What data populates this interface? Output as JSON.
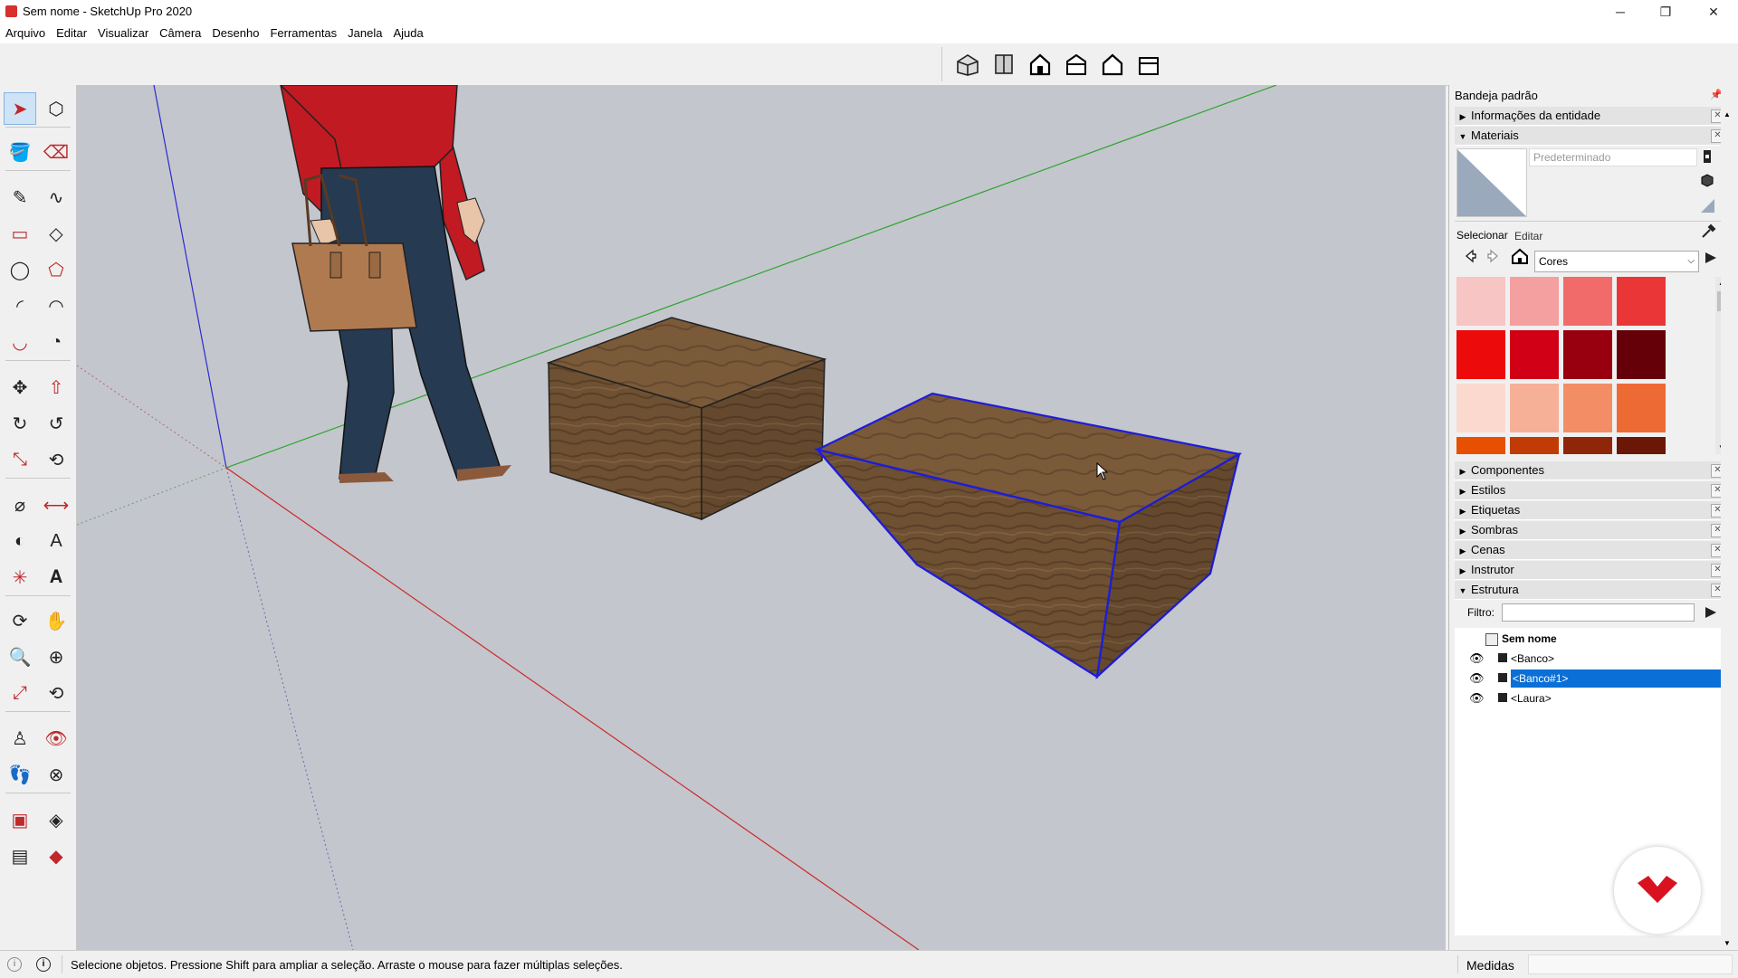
{
  "window": {
    "title": "Sem nome - SketchUp Pro 2020",
    "minimize": "─",
    "restore": "❐",
    "close": "✕"
  },
  "menu": [
    "Arquivo",
    "Editar",
    "Visualizar",
    "Câmera",
    "Desenho",
    "Ferramentas",
    "Janela",
    "Ajuda"
  ],
  "view_toolbar": [
    "iso-view-icon",
    "top-view-icon",
    "front-view-icon",
    "right-view-icon",
    "back-view-icon",
    "left-view-icon"
  ],
  "left_tools": [
    "select-tool-icon",
    "make-component-icon",
    "paint-bucket-icon",
    "eraser-icon",
    "line-tool-icon",
    "freehand-tool-icon",
    "rectangle-tool-icon",
    "rotated-rectangle-icon",
    "circle-tool-icon",
    "polygon-tool-icon",
    "arc-tool-icon",
    "two-point-arc-icon",
    "three-point-arc-icon",
    "pie-tool-icon",
    "move-tool-icon",
    "push-pull-icon",
    "rotate-tool-icon",
    "follow-me-icon",
    "scale-tool-icon",
    "offset-tool-icon",
    "tape-measure-icon",
    "dimension-tool-icon",
    "protractor-icon",
    "text-tool-icon",
    "axes-tool-icon",
    "3d-text-icon",
    "orbit-tool-icon",
    "pan-tool-icon",
    "zoom-tool-icon",
    "zoom-window-icon",
    "zoom-extents-icon",
    "previous-view-icon",
    "position-camera-icon",
    "look-around-icon",
    "walk-tool-icon",
    "section-plane-icon",
    "warehouse-icon",
    "extension-warehouse-icon",
    "send-to-layout-icon",
    "extension-manager-icon"
  ],
  "tray": {
    "title": "Bandeja padrão",
    "panels": {
      "entity_info": "Informações da entidade",
      "materials": "Materiais",
      "components": "Componentes",
      "styles": "Estilos",
      "tags": "Etiquetas",
      "shadows": "Sombras",
      "scenes": "Cenas",
      "instructor": "Instrutor",
      "outliner": "Estrutura"
    },
    "materials": {
      "name_placeholder": "Predeterminado",
      "tab_select": "Selecionar",
      "tab_edit": "Editar",
      "library": "Cores",
      "swatches": [
        "#f8c5c5",
        "#f4a0a0",
        "#f26b6b",
        "#ea3636",
        "#ec0a0a",
        "#d10017",
        "#980010",
        "#650008",
        "#fcd9ce",
        "#f7b098",
        "#f38d66",
        "#ee6a35",
        "#e65000",
        "#c13c05",
        "#8f260a",
        "#6b1707"
      ]
    },
    "outliner": {
      "filter_label": "Filtro:",
      "filter_value": "",
      "root": "Sem nome",
      "items": [
        "<Banco>",
        "<Banco#1>",
        "<Laura>"
      ],
      "selected_index": 1
    }
  },
  "status": {
    "message": "Selecione objetos. Pressione Shift para ampliar a seleção. Arraste o mouse para fazer múltiplas seleções.",
    "measurements_label": "Medidas",
    "measurements_value": ""
  },
  "colors": {
    "selection_blue": "#0a6fd6",
    "selection_edge": "#1d1ddb",
    "wood": "#6e5032",
    "axis_red": "#cc2a2a",
    "axis_green": "#2fa52f",
    "axis_blue": "#2a2ad0"
  }
}
